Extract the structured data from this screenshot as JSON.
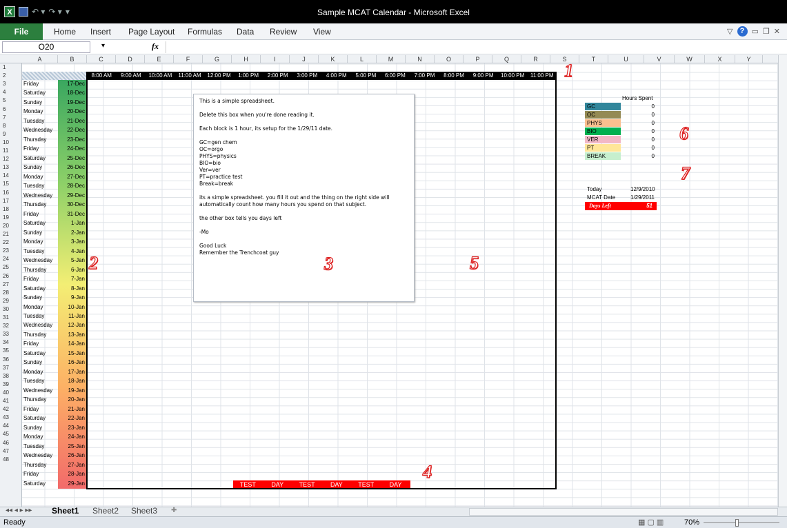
{
  "window": {
    "title": "Sample MCAT Calendar - Microsoft Excel"
  },
  "ribbon": {
    "file": "File",
    "tabs": [
      "Home",
      "Insert",
      "Page Layout",
      "Formulas",
      "Data",
      "Review",
      "View"
    ]
  },
  "formula_bar": {
    "name_box": "O20",
    "fx": "fx",
    "formula": ""
  },
  "columns": [
    "A",
    "B",
    "C",
    "D",
    "E",
    "F",
    "G",
    "H",
    "I",
    "J",
    "K",
    "L",
    "M",
    "N",
    "O",
    "P",
    "Q",
    "R",
    "S",
    "T",
    "U",
    "V",
    "W",
    "X",
    "Y"
  ],
  "hours": [
    "8:00 AM",
    "9:00 AM",
    "10:00 AM",
    "11:00 AM",
    "12:00 PM",
    "1:00 PM",
    "2:00 PM",
    "3:00 PM",
    "4:00 PM",
    "5:00 PM",
    "6:00 PM",
    "7:00 PM",
    "8:00 PM",
    "9:00 PM",
    "10:00 PM",
    "11:00 PM"
  ],
  "days": [
    [
      "Friday",
      "17-Dec"
    ],
    [
      "Saturday",
      "18-Dec"
    ],
    [
      "Sunday",
      "19-Dec"
    ],
    [
      "Monday",
      "20-Dec"
    ],
    [
      "Tuesday",
      "21-Dec"
    ],
    [
      "Wednesday",
      "22-Dec"
    ],
    [
      "Thursday",
      "23-Dec"
    ],
    [
      "Friday",
      "24-Dec"
    ],
    [
      "Saturday",
      "25-Dec"
    ],
    [
      "Sunday",
      "26-Dec"
    ],
    [
      "Monday",
      "27-Dec"
    ],
    [
      "Tuesday",
      "28-Dec"
    ],
    [
      "Wednesday",
      "29-Dec"
    ],
    [
      "Thursday",
      "30-Dec"
    ],
    [
      "Friday",
      "31-Dec"
    ],
    [
      "Saturday",
      "1-Jan"
    ],
    [
      "Sunday",
      "2-Jan"
    ],
    [
      "Monday",
      "3-Jan"
    ],
    [
      "Tuesday",
      "4-Jan"
    ],
    [
      "Wednesday",
      "5-Jan"
    ],
    [
      "Thursday",
      "6-Jan"
    ],
    [
      "Friday",
      "7-Jan"
    ],
    [
      "Saturday",
      "8-Jan"
    ],
    [
      "Sunday",
      "9-Jan"
    ],
    [
      "Monday",
      "10-Jan"
    ],
    [
      "Tuesday",
      "11-Jan"
    ],
    [
      "Wednesday",
      "12-Jan"
    ],
    [
      "Thursday",
      "13-Jan"
    ],
    [
      "Friday",
      "14-Jan"
    ],
    [
      "Saturday",
      "15-Jan"
    ],
    [
      "Sunday",
      "16-Jan"
    ],
    [
      "Monday",
      "17-Jan"
    ],
    [
      "Tuesday",
      "18-Jan"
    ],
    [
      "Wednesday",
      "19-Jan"
    ],
    [
      "Thursday",
      "20-Jan"
    ],
    [
      "Friday",
      "21-Jan"
    ],
    [
      "Saturday",
      "22-Jan"
    ],
    [
      "Sunday",
      "23-Jan"
    ],
    [
      "Monday",
      "24-Jan"
    ],
    [
      "Tuesday",
      "25-Jan"
    ],
    [
      "Wednesday",
      "26-Jan"
    ],
    [
      "Thursday",
      "27-Jan"
    ],
    [
      "Friday",
      "28-Jan"
    ],
    [
      "Saturday",
      "29-Jan"
    ]
  ],
  "test_row": [
    "TEST",
    "DAY",
    "TEST",
    "DAY",
    "TEST",
    "DAY"
  ],
  "note": [
    "This is a simple spreadsheet.",
    "",
    "Delete this box when you're done reading it.",
    "",
    "Each block is 1 hour, its setup for the 1/29/11 date.",
    "",
    "GC=gen chem",
    "OC=orgo",
    "PHYS=physics",
    "BIO=bio",
    "Ver=ver",
    "PT=practice test",
    "Break=break",
    "",
    "its a simple spreadsheet. you fill it out and the thing on the right side will",
    "automatically count how many hours you spend on that subject.",
    "",
    "the other box tells you days left",
    "",
    "-Mo",
    "",
    "Good Luck",
    "Remember the Trenchcoat guy"
  ],
  "hours_spent": {
    "header": "Hours Spent",
    "rows": [
      {
        "label": "GC",
        "value": "0",
        "color": "#31869b"
      },
      {
        "label": "OC",
        "value": "0",
        "color": "#948a54"
      },
      {
        "label": "PHYS",
        "value": "0",
        "color": "#fabf8f"
      },
      {
        "label": "BIO",
        "value": "0",
        "color": "#00b050"
      },
      {
        "label": "VER",
        "value": "0",
        "color": "#f2b8c6"
      },
      {
        "label": "PT",
        "value": "0",
        "color": "#ffe699"
      },
      {
        "label": "BREAK",
        "value": "0",
        "color": "#c6efce"
      }
    ]
  },
  "countdown": {
    "today_label": "Today",
    "today": "12/9/2010",
    "mcat_label": "MCAT Date",
    "mcat": "1/29/2011",
    "left_label": "Days Left",
    "left": "51"
  },
  "markers": [
    "1",
    "2",
    "3",
    "4",
    "5",
    "6",
    "7"
  ],
  "sheets": [
    "Sheet1",
    "Sheet2",
    "Sheet3"
  ],
  "status": {
    "ready": "Ready",
    "zoom": "70%"
  }
}
